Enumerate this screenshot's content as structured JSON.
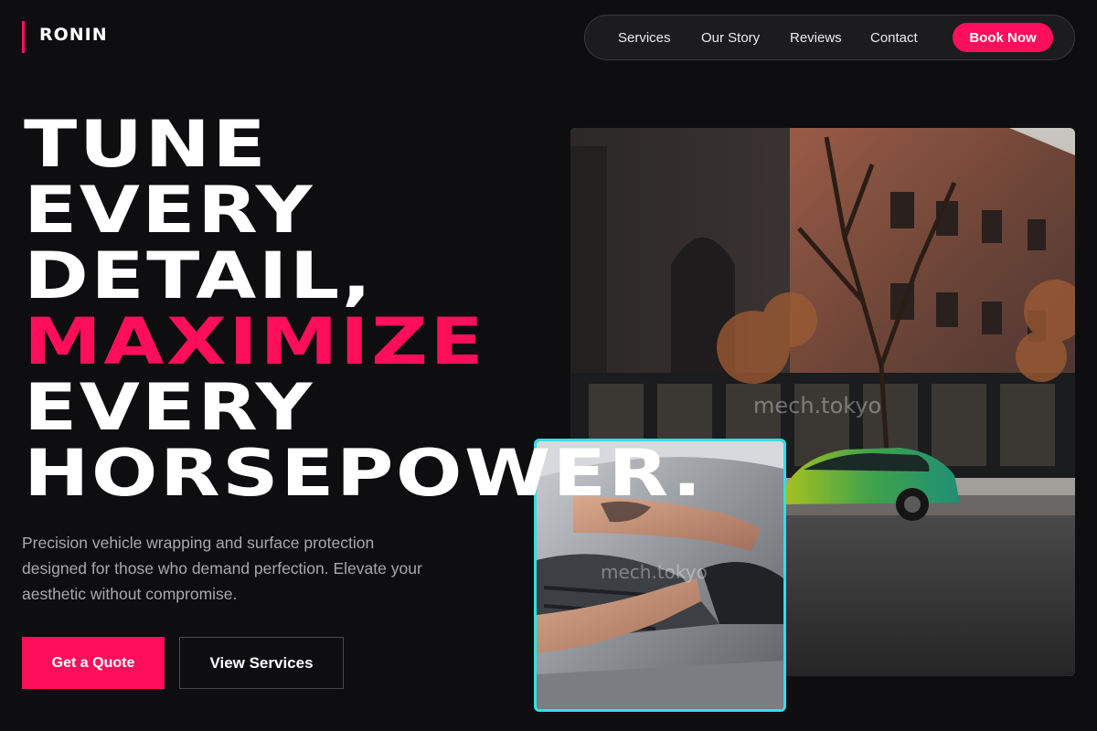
{
  "brand": {
    "name": "RONIN",
    "accent": "#ff0f5b"
  },
  "nav": {
    "links": [
      "Services",
      "Our Story",
      "Reviews",
      "Contact"
    ],
    "cta": "Book Now"
  },
  "hero": {
    "lines": [
      "TUNE",
      "EVERY",
      "DETAIL,",
      "MAXIMIZE",
      "EVERY",
      "HORSEPOWER."
    ],
    "highlight_line": "MAXIMIZE",
    "subtext": "Precision vehicle wrapping and surface protection designed for those who demand perfection. Elevate your aesthetic without compromise.",
    "primary_button": "Get a Quote",
    "secondary_button": "View Services"
  },
  "images": {
    "main_watermark": "mech.tokyo",
    "detail_watermark": "mech.tokyo",
    "detail_border_color": "#2ee0e6"
  }
}
